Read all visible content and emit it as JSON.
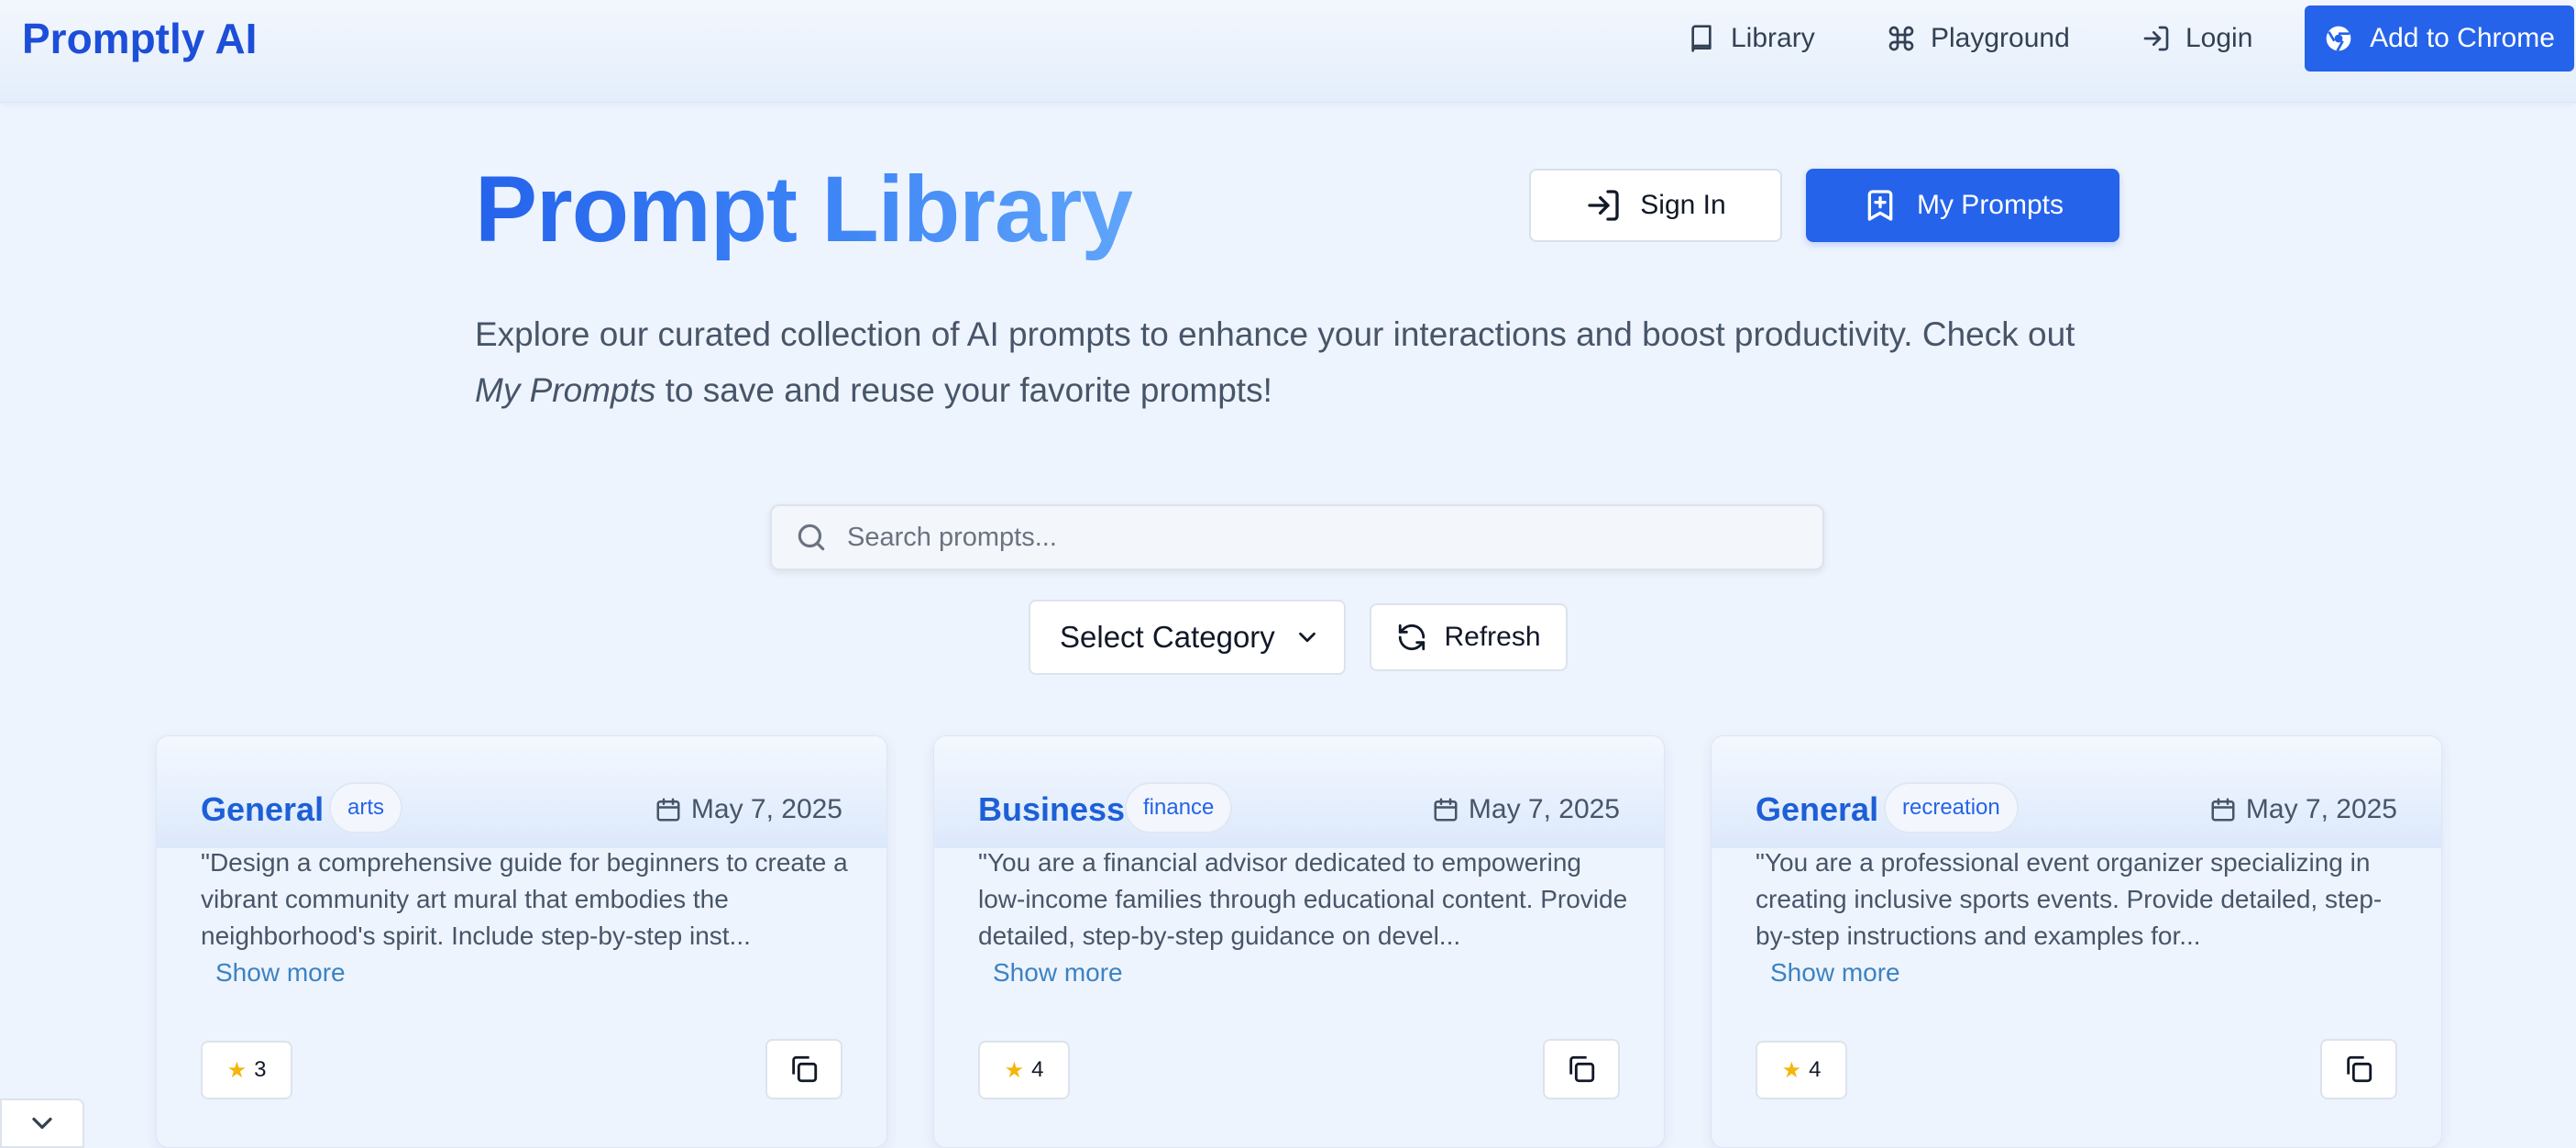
{
  "nav": {
    "brand": "Promptly AI",
    "links": [
      {
        "label": "Library",
        "icon": "book-icon"
      },
      {
        "label": "Playground",
        "icon": "command-icon"
      },
      {
        "label": "Login",
        "icon": "login-icon"
      }
    ],
    "cta": {
      "label": "Add to Chrome",
      "icon": "chrome-icon"
    }
  },
  "hero": {
    "title_part1": "Prompt",
    "title_part2": "Library",
    "signin_label": "Sign In",
    "myprompts_label": "My Prompts",
    "desc_before": "Explore our curated collection of AI prompts to enhance your interactions and boost productivity. Check out ",
    "desc_em": "My Prompts",
    "desc_after": " to save and reuse your favorite prompts!"
  },
  "search": {
    "placeholder": "Search prompts..."
  },
  "filters": {
    "category_label": "Select Category",
    "refresh_label": "Refresh"
  },
  "cards": [
    {
      "category": "General",
      "tag": "arts",
      "date": "May 7, 2025",
      "text": "\"Design a comprehensive guide for beginners to create a vibrant community art mural that embodies the neighborhood's spirit. Include step-by-step inst...",
      "show_more": "Show more",
      "rating": "3"
    },
    {
      "category": "Business",
      "tag": "finance",
      "date": "May 7, 2025",
      "text": "\"You are a financial advisor dedicated to empowering low-income families through educational content. Provide detailed, step-by-step guidance on devel...",
      "show_more": "Show more",
      "rating": "4"
    },
    {
      "category": "General",
      "tag": "recreation",
      "date": "May 7, 2025",
      "text": "\"You are a professional event organizer specializing in creating inclusive sports events. Provide detailed, step-by-step instructions and examples for...",
      "show_more": "Show more",
      "rating": "4"
    }
  ],
  "colors": {
    "accent": "#2563eb",
    "brand": "#1d4ed8",
    "background": "#eef4fd"
  }
}
